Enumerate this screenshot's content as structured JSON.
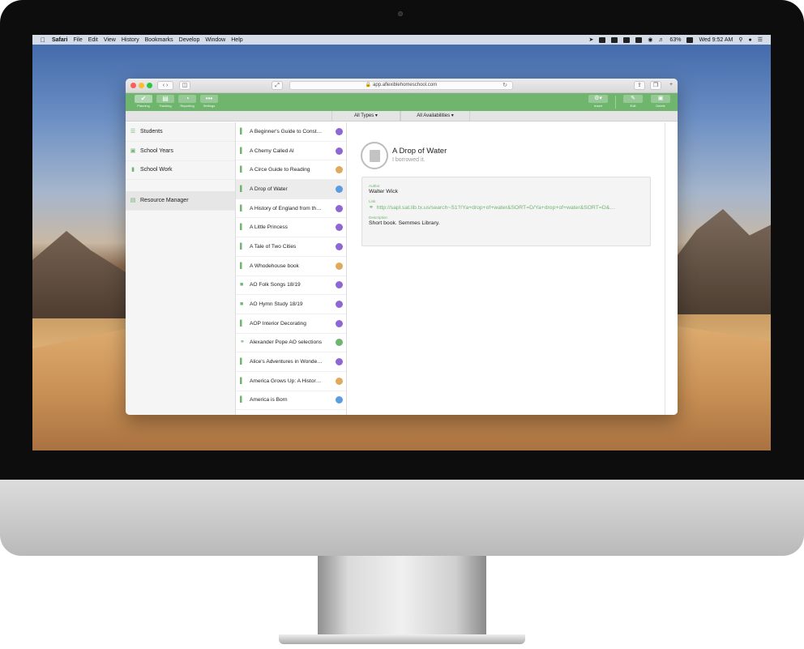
{
  "menubar": {
    "items": [
      "Safari",
      "File",
      "Edit",
      "View",
      "History",
      "Bookmarks",
      "Develop",
      "Window",
      "Help"
    ],
    "battery": "63%",
    "clock": "Wed 9:52 AM"
  },
  "browser": {
    "url": "app.aflexiblehomeschool.com"
  },
  "toolbar": {
    "tabs": [
      {
        "label": "Planning",
        "icon": "check-icon"
      },
      {
        "label": "Tracking",
        "icon": "chart-icon"
      },
      {
        "label": "Reporting",
        "icon": "pie-icon"
      },
      {
        "label": "Settings",
        "icon": "more-icon"
      }
    ],
    "insert_label": "Insert",
    "edit_label": "Edit",
    "delete_label": "Delete",
    "accent": "#6fb56e"
  },
  "filters": {
    "types": "All Types",
    "availabilities": "All Availabilities"
  },
  "sidebar": {
    "items": [
      {
        "label": "Students",
        "icon": "graduation-cap-icon"
      },
      {
        "label": "School Years",
        "icon": "calendar-icon"
      },
      {
        "label": "School Work",
        "icon": "book-icon"
      },
      {
        "label": "Resource Manager",
        "icon": "archive-icon"
      }
    ]
  },
  "resources": [
    {
      "title": "A Beginner's Guide to Const…",
      "icon": "book-icon",
      "badge_color": "#8e66d6"
    },
    {
      "title": "A Chemy Called Al",
      "icon": "book-icon",
      "badge_color": "#8e66d6"
    },
    {
      "title": "A Circe Guide to Reading",
      "icon": "book-icon",
      "badge_color": "#e0a95c"
    },
    {
      "title": "A Drop of Water",
      "icon": "book-icon",
      "badge_color": "#5b9de0"
    },
    {
      "title": "A History of England from th…",
      "icon": "book-icon",
      "badge_color": "#8e66d6"
    },
    {
      "title": "A Little Princess",
      "icon": "book-icon",
      "badge_color": "#8e66d6"
    },
    {
      "title": "A Tale of Two Cities",
      "icon": "book-icon",
      "badge_color": "#8e66d6"
    },
    {
      "title": "A Whodehouse book",
      "icon": "book-icon",
      "badge_color": "#e0a95c"
    },
    {
      "title": "AO Folk Songs 18/19",
      "icon": "video-icon",
      "badge_color": "#8e66d6"
    },
    {
      "title": "AO Hymn Study 18/19",
      "icon": "video-icon",
      "badge_color": "#8e66d6"
    },
    {
      "title": "AOP Interior Decorating",
      "icon": "book-icon",
      "badge_color": "#8e66d6"
    },
    {
      "title": "Alexander Pope AO selections",
      "icon": "link-icon",
      "badge_color": "#6fb56e"
    },
    {
      "title": "Alice's Adventures in Wonde…",
      "icon": "book-icon",
      "badge_color": "#8e66d6"
    },
    {
      "title": "America Grows Up: A Histor…",
      "icon": "book-icon",
      "badge_color": "#e0a95c"
    },
    {
      "title": "America is Born",
      "icon": "book-icon",
      "badge_color": "#5b9de0"
    }
  ],
  "detail": {
    "title": "A Drop of Water",
    "subtitle": "I borrowed it.",
    "author_label": "Author",
    "author": "Walter Wick",
    "link_label": "Link",
    "link": "http://sapl.sat.lib.tx.us/search~S1?/Ya+drop+of+water&SORT=D/Ya+drop+of+water&SORT=D&…",
    "description_label": "Description",
    "description": "Short book. Semmes Library."
  }
}
